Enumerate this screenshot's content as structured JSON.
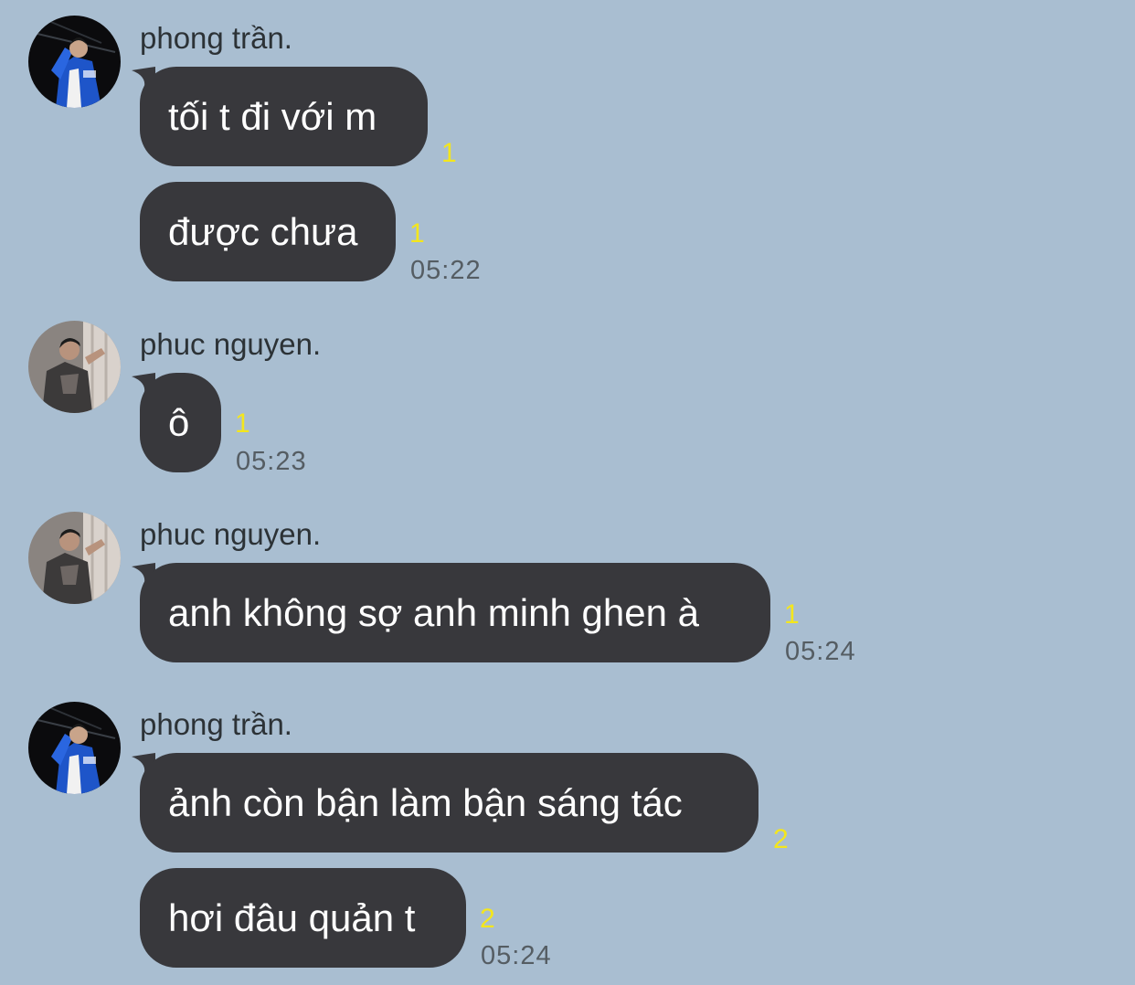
{
  "groups": [
    {
      "sender": "phong trần.",
      "avatar_icon": "avatar-phong-icon",
      "messages": [
        {
          "text": "tối t đi với m",
          "unread": "1"
        },
        {
          "text": "được chưa",
          "unread": "1",
          "time": "05:22"
        }
      ]
    },
    {
      "sender": "phuc nguyen.",
      "avatar_icon": "avatar-phuc-icon",
      "messages": [
        {
          "text": "ô",
          "unread": "1",
          "time": "05:23"
        }
      ]
    },
    {
      "sender": "phuc nguyen.",
      "avatar_icon": "avatar-phuc-icon",
      "messages": [
        {
          "text": "anh không sợ anh minh ghen à",
          "unread": "1",
          "time": "05:24"
        }
      ]
    },
    {
      "sender": "phong trần.",
      "avatar_icon": "avatar-phong-icon",
      "messages": [
        {
          "text": "ảnh còn bận làm bận sáng tác",
          "unread": "2"
        },
        {
          "text": "hơi đâu quản t",
          "unread": "2",
          "time": "05:24"
        }
      ]
    }
  ],
  "colors": {
    "background": "#a9bed1",
    "bubble": "#38383c",
    "bubble_text": "#ffffff",
    "unread": "#f4e61c",
    "time": "#555d63"
  }
}
